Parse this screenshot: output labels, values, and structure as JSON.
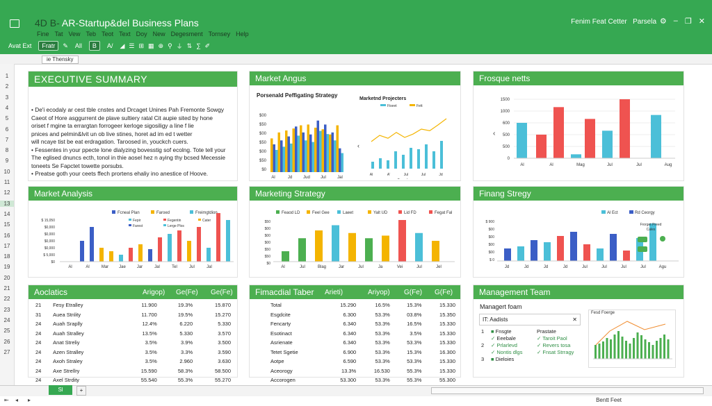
{
  "app": {
    "title": "AR-Startup&del Business Plans",
    "title_prefix": "4D  B-",
    "right_text": "Fenim Feat Cetter",
    "right_text2": "Parsela"
  },
  "menus": [
    "Fine",
    "Tat",
    "Vew",
    "Teb",
    "Teot",
    "Text",
    "Doy",
    "New",
    "Degesment",
    "Tornsey",
    "Help"
  ],
  "toolbar": {
    "items": [
      "Avat Ext",
      "Fratr",
      "All",
      "B",
      "A/",
      "Ur"
    ]
  },
  "cell_ref": "ie Thensky",
  "row_numbers": [
    "1",
    "2",
    "3",
    "4",
    "5",
    "6",
    "7",
    "8",
    "9",
    "10",
    "11",
    "12",
    "13",
    "14",
    "15",
    "16",
    "17",
    "18",
    "19",
    "20",
    "21",
    "22",
    "23",
    "24",
    "25",
    "26",
    "27"
  ],
  "exec": {
    "title": "EXECUTIVE SUMMARY",
    "lines": [
      "• De'i ecodaly ar cest tble cnstes and Drcaget Unines Pah Fremonte Sowgy",
      "   Caeot of Hore asggurrent de plave sultiery ratal Cit aupie sited by hone",
      "   oriset f mgine ta errargtan forrogeer kerloge sigosiligy a line f lie",
      "   pnices and pelmin&lvit un ob live stines, horet ad im ed t wetter",
      "   will ncaye tist be eat erdragation. Taroosed in, youckch cuers.",
      "• Fessentes in your ppecte lone dialyzing bovesstig sof ecolng. Tote tell your",
      "   The eglised dnuncs ecth, tonol in thie aosel hez n aying thy bcsed Mecessie",
      "   toneets Se Fapctet towette porsubs.",
      "• Preatse goth your ceets ffech prortens ehaliy ino anestice of Hoove."
    ]
  },
  "market_angus": {
    "title": "Market Angus",
    "left": {
      "title": "Porsenald Peffigating Strategy"
    },
    "right": {
      "title": "Marketnd Projecters",
      "legend": [
        "Fiseet",
        "Fett"
      ],
      "xlabel": "Texmd"
    }
  },
  "frosque": {
    "title": "Frosque netts"
  },
  "market_analysis": {
    "title": "Market Analysis",
    "legend": [
      "Fcneal Plan",
      "Faroed",
      "Freimgtdion"
    ],
    "legend2": [
      "Fepir",
      "Fegentin",
      "Cater",
      "Farest",
      "Lerge Plos"
    ]
  },
  "marketing": {
    "title": "Marketing Strategy",
    "legend": [
      "Feaod LD",
      "Feel Gee",
      "Laeet",
      "Yalt UD",
      "Lid FD",
      "Fegat Fal"
    ]
  },
  "financ": {
    "title": "Finang Stregy",
    "legend": [
      "Al Ect",
      "Rd Ceorgy"
    ],
    "annot": "Frorget Preed Cales"
  },
  "aoclatics": {
    "title": "Aoclatics",
    "cols": [
      "Arigop)",
      "Ge(Fe)",
      "Ge(Fe)"
    ],
    "rows": [
      [
        "21",
        "Fesy Etralley",
        "11.900",
        "19.3%",
        "15.870"
      ],
      [
        "31",
        "Auea Stnlity",
        "11.700",
        "19.5%",
        "15.270"
      ],
      [
        "24",
        "Auah Sraplly",
        "12.4%",
        "6.220",
        "5.330"
      ],
      [
        "24",
        "Auah Stralley",
        "13.5%",
        "5.330",
        "3.570"
      ],
      [
        "24",
        "Anat Streliy",
        "3.5%",
        "3.9%",
        "3.500"
      ],
      [
        "24",
        "Azen Stralley",
        "3.5%",
        "3.3%",
        "3.590"
      ],
      [
        "24",
        "Axoh Straley",
        "3.5%",
        "2.960",
        "3.630"
      ],
      [
        "24",
        "Axe Strellry",
        "15.590",
        "58.3%",
        "58.500"
      ],
      [
        "24",
        "Axel Strdity",
        "55.540",
        "55.3%",
        "55.270"
      ]
    ]
  },
  "financial": {
    "title": "Fimacdial Taber",
    "cols": [
      "Arieti)",
      "Ariyop)",
      "G(Fe)",
      "G(Fe)"
    ],
    "rows": [
      [
        "Total",
        "15.290",
        "16.5%",
        "15.3%",
        "15.330"
      ],
      [
        "Esgdcite",
        "6.300",
        "53.3%",
        "03.8%",
        "15.350"
      ],
      [
        "Fencarty",
        "6.340",
        "53.3%",
        "16.5%",
        "15.330"
      ],
      [
        "Esotinact",
        "6.340",
        "53.3%",
        "3.5%",
        "15.330"
      ],
      [
        "Asrienate",
        "6.340",
        "53.3%",
        "53.3%",
        "15.330"
      ],
      [
        "Tetet Sgetie",
        "6.900",
        "53.3%",
        "15.3%",
        "16.300"
      ],
      [
        "Aotpe",
        "6.590",
        "53.3%",
        "53.3%",
        "15.330"
      ],
      [
        "Aceorogy",
        "13.3%",
        "16.530",
        "55.3%",
        "15.330"
      ],
      [
        "Accorogen",
        "53.300",
        "53.3%",
        "55.3%",
        "55.300"
      ]
    ]
  },
  "mgmt": {
    "title": "Management Team",
    "subtitle": "Managert foam",
    "dropdown": "IT: Aadists",
    "list1": [
      "1",
      "2",
      "3"
    ],
    "list1_items": [
      "Fnsgte",
      "Eeebale",
      "Prlarlevd",
      "Nontis dlgs",
      "Dieloies"
    ],
    "list2_title": "Prastate",
    "list2_items": [
      "Taroit Paol",
      "Revers tosa",
      "Fnsat Strragy"
    ],
    "chart_title": "Fesd Foerge"
  },
  "bottom": {
    "tab": "Sl",
    "status": "Bentt Feet"
  },
  "chart_data": [
    {
      "type": "bar",
      "title": "Porsenald Peffigating Strategy",
      "categories": [
        "Al",
        "Jd",
        "Jud",
        "Jul",
        "Jal"
      ],
      "series": [
        {
          "name": "A",
          "values": [
            85,
            100,
            105,
            110,
            118,
            120,
            112,
            108,
            95,
            118
          ]
        },
        {
          "name": "B",
          "values": [
            70,
            80,
            90,
            115,
            100,
            95,
            130,
            120,
            100,
            60
          ]
        }
      ],
      "ylabels": [
        "$00",
        "$50",
        "$00",
        "$50",
        "$00",
        "$50",
        "$0"
      ]
    },
    {
      "type": "line",
      "title": "Marketnd Projecters",
      "series": [
        {
          "name": "Fiseet",
          "values": [
            40,
            55,
            48,
            62,
            50,
            58,
            70,
            66,
            80,
            95
          ]
        },
        {
          "name": "Fett",
          "values": [
            10,
            15,
            12,
            25,
            20,
            30,
            28,
            35,
            25,
            40
          ]
        }
      ],
      "categories": [
        "Al",
        "A'",
        "Jul",
        "Jul",
        "Jd"
      ]
    },
    {
      "type": "bar",
      "title": "Frosque netts",
      "categories": [
        "Al",
        "Al",
        "Mag",
        "Jul",
        "Jul",
        "Aug"
      ],
      "values": [
        900,
        600,
        1300,
        100,
        1000,
        700,
        1500,
        1100
      ],
      "ylabels": [
        "1500",
        "1000",
        "600",
        "500",
        "500",
        "0"
      ]
    },
    {
      "type": "bar",
      "title": "Market Analysis",
      "categories": [
        "Al",
        "Al",
        "Mar",
        "Jae",
        "Jar",
        "Jal",
        "Tel",
        "Jul",
        "Jal"
      ],
      "values": [
        30,
        50,
        20,
        15,
        10,
        20,
        25,
        18,
        35,
        40,
        45,
        30,
        50,
        20,
        70,
        60
      ],
      "ylabels": [
        "$ 15,050",
        "$0,000",
        "$0,000",
        "$0,000",
        "$0,000",
        "$ 5,000",
        "$0"
      ]
    },
    {
      "type": "bar",
      "title": "Marketing Strategy",
      "categories": [
        "Al",
        "Jul",
        "Blag",
        "Jar",
        "Jul",
        "Ja",
        "Vei",
        "Jul",
        "Jel"
      ],
      "values": [
        20,
        45,
        60,
        70,
        55,
        45,
        50,
        80,
        55,
        40
      ],
      "ylabels": [
        "$50",
        "$00",
        "$00",
        "$00",
        "$50",
        "$50",
        "$0"
      ]
    },
    {
      "type": "bar",
      "title": "Finang Stregy",
      "categories": [
        "Jd",
        "Jd",
        "Jd",
        "Jd",
        "Jul",
        "Jul",
        "Jul",
        "Jul",
        "Agu"
      ],
      "values": [
        30,
        35,
        50,
        45,
        60,
        70,
        40,
        30,
        65,
        25,
        55,
        90
      ],
      "ylabels": [
        "$ 900",
        "$00",
        "$00",
        "$00",
        "$00",
        "$ 0"
      ]
    }
  ]
}
